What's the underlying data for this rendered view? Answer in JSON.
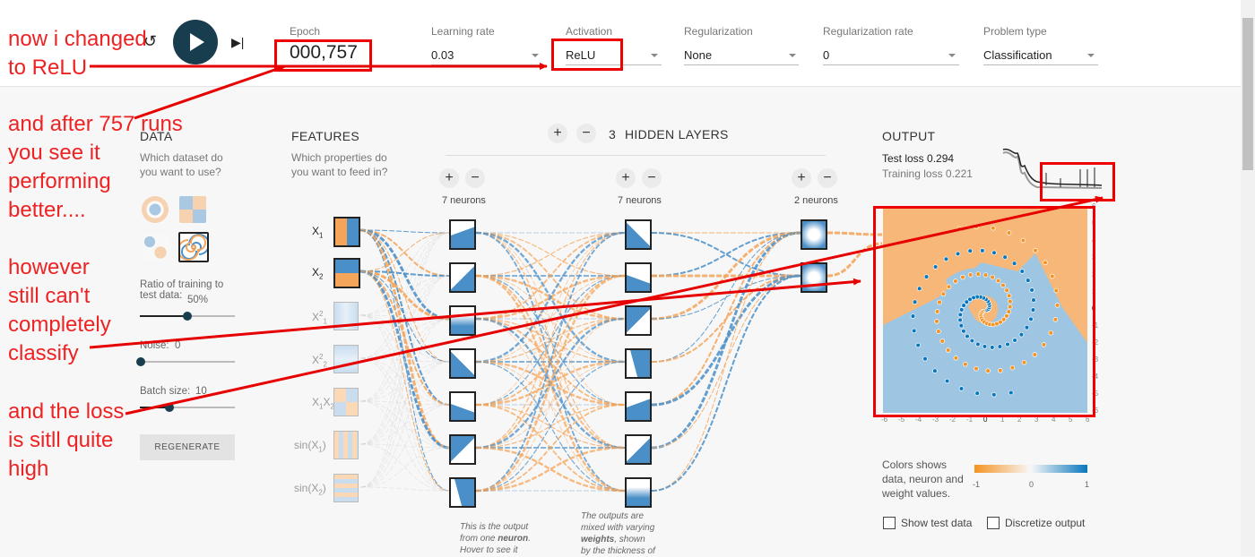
{
  "controls": {
    "epoch_label": "Epoch",
    "epoch_value": "000,757",
    "learning_rate_label": "Learning rate",
    "learning_rate_value": "0.03",
    "activation_label": "Activation",
    "activation_value": "ReLU",
    "regularization_label": "Regularization",
    "regularization_value": "None",
    "regularization_rate_label": "Regularization rate",
    "regularization_rate_value": "0",
    "problem_type_label": "Problem type",
    "problem_type_value": "Classification"
  },
  "data_panel": {
    "title": "DATA",
    "subtitle": "Which dataset do you want to use?",
    "ratio_label": "Ratio of training to test data:",
    "ratio_value": "50%",
    "ratio_fraction": 0.5,
    "noise_label": "Noise:",
    "noise_value": "0",
    "batch_label": "Batch size:",
    "batch_value": "10",
    "regenerate_label": "REGENERATE"
  },
  "features_panel": {
    "title": "FEATURES",
    "subtitle": "Which properties do you want to feed in?",
    "features": [
      {
        "base": "X",
        "sub": "1",
        "active": true
      },
      {
        "base": "X",
        "sub": "2",
        "active": true
      },
      {
        "base": "X",
        "sub": "1",
        "sup": "2",
        "active": false
      },
      {
        "base": "X",
        "sub": "2",
        "sup": "2",
        "active": false
      },
      {
        "base": "X",
        "sub": "1",
        "base2": "X",
        "sub2": "2",
        "active": false
      },
      {
        "base": "sin(X",
        "sub": "1",
        "tail": ")",
        "active": false
      },
      {
        "base": "sin(X",
        "sub": "2",
        "tail": ")",
        "active": false
      }
    ]
  },
  "network": {
    "hidden_layers_count": "3",
    "hidden_layers_label": "HIDDEN LAYERS",
    "layer1_label": "7 neurons",
    "layer2_label": "7 neurons",
    "layer3_label": "2 neurons",
    "note1": [
      "This is the output",
      "from one ",
      "neuron",
      ".",
      "Hover to see it"
    ],
    "note2": [
      "The outputs are",
      "mixed with varying",
      "weights",
      ", shown",
      "by the thickness of"
    ]
  },
  "output_panel": {
    "title": "OUTPUT",
    "test_loss": "Test loss 0.294",
    "training_loss": "Training loss 0.221",
    "colors_label": "Colors shows data, neuron and weight values.",
    "scale_min": "-1",
    "scale_mid": "0",
    "scale_max": "1",
    "show_test_label": "Show test data",
    "discretize_label": "Discretize output",
    "x_ticks": [
      "-6",
      "-5",
      "-4",
      "-3",
      "-2",
      "-1",
      "0",
      "1",
      "2",
      "3",
      "4",
      "5",
      "6"
    ],
    "y_ticks": [
      "6",
      "5",
      "4",
      "3",
      "2",
      "1",
      "0",
      "-1",
      "-2",
      "-3",
      "-4",
      "-5",
      "-6"
    ]
  },
  "annotations": {
    "a1_line1": "now i changed",
    "a1_line2": "to ReLU",
    "a2_line1": "and after 757 runs",
    "a2_line2": "you see it",
    "a2_line3": "performing",
    "a2_line4": "better....",
    "a3_line1": "however",
    "a3_line2": "still can't",
    "a3_line3": "completely",
    "a3_line4": "classify",
    "a4_line1": "and the loss",
    "a4_line2": "is sitll quite",
    "a4_line3": "high"
  },
  "colors": {
    "orange": "#f5a55a",
    "blue": "#4b8fc8",
    "annotation": "#e60000",
    "play": "#183d4e"
  }
}
